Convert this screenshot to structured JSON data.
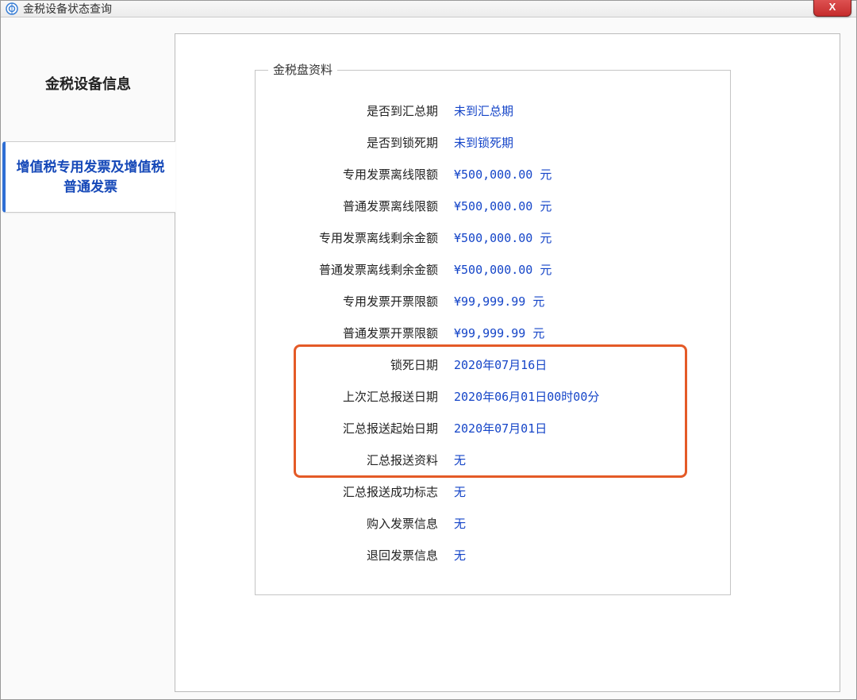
{
  "window": {
    "title": "金税设备状态查询",
    "close_glyph": "X"
  },
  "sidebar": {
    "heading": "金税设备信息",
    "items": [
      {
        "label": "增值税专用发票及增值税普通发票"
      }
    ]
  },
  "panel": {
    "legend": "金税盘资料",
    "rows": [
      {
        "label": "是否到汇总期",
        "value": "未到汇总期"
      },
      {
        "label": "是否到锁死期",
        "value": "未到锁死期"
      },
      {
        "label": "专用发票离线限额",
        "value": "¥500,000.00 元"
      },
      {
        "label": "普通发票离线限额",
        "value": "¥500,000.00 元"
      },
      {
        "label": "专用发票离线剩余金额",
        "value": "¥500,000.00 元"
      },
      {
        "label": "普通发票离线剩余金额",
        "value": "¥500,000.00 元"
      },
      {
        "label": "专用发票开票限额",
        "value": "¥99,999.99 元"
      },
      {
        "label": "普通发票开票限额",
        "value": "¥99,999.99 元"
      },
      {
        "label": "锁死日期",
        "value": "2020年07月16日"
      },
      {
        "label": "上次汇总报送日期",
        "value": "2020年06月01日00时00分"
      },
      {
        "label": "汇总报送起始日期",
        "value": "2020年07月01日"
      },
      {
        "label": "汇总报送资料",
        "value": "无"
      },
      {
        "label": "汇总报送成功标志",
        "value": "无"
      },
      {
        "label": "购入发票信息",
        "value": "无"
      },
      {
        "label": "退回发票信息",
        "value": "无"
      }
    ],
    "highlighted_row_indices": [
      8,
      9,
      10,
      11
    ]
  }
}
